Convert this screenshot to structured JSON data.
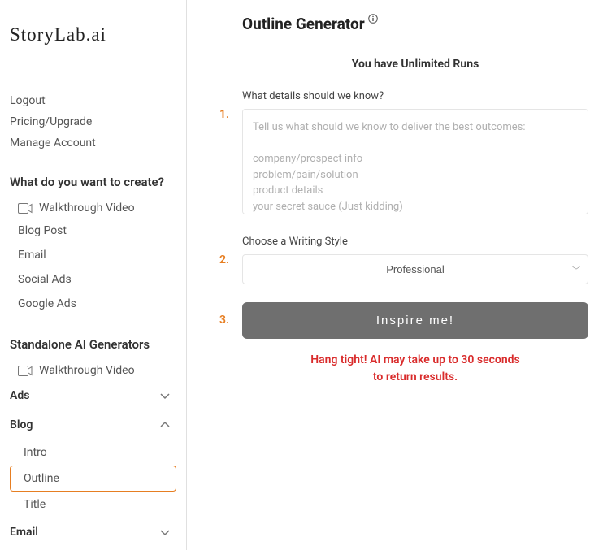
{
  "logo": "StoryLab.ai",
  "account_links": {
    "logout": "Logout",
    "pricing": "Pricing/Upgrade",
    "manage": "Manage Account"
  },
  "create": {
    "heading": "What do you want to create?",
    "walkthrough": "Walkthrough Video",
    "items": [
      "Blog Post",
      "Email",
      "Social Ads",
      "Google Ads"
    ]
  },
  "standalone": {
    "heading": "Standalone AI Generators",
    "walkthrough": "Walkthrough Video",
    "groups": {
      "ads": "Ads",
      "blog": "Blog",
      "email": "Email"
    },
    "blog_items": {
      "intro": "Intro",
      "outline": "Outline",
      "title": "Title"
    }
  },
  "main": {
    "title": "Outline Generator",
    "runs": "You have Unlimited Runs",
    "steps": {
      "s1": "1.",
      "s2": "2.",
      "s3": "3."
    },
    "details_label": "What details should we know?",
    "details_placeholder": "Tell us what should we know to deliver the best outcomes:\n\ncompany/prospect info\nproblem/pain/solution\nproduct details\nyour secret sauce (Just kidding)",
    "style_label": "Choose a Writing Style",
    "style_value": "Professional",
    "button": "Inspire me!",
    "wait_l1": "Hang tight! AI may take up to 30 seconds",
    "wait_l2": "to return results."
  }
}
